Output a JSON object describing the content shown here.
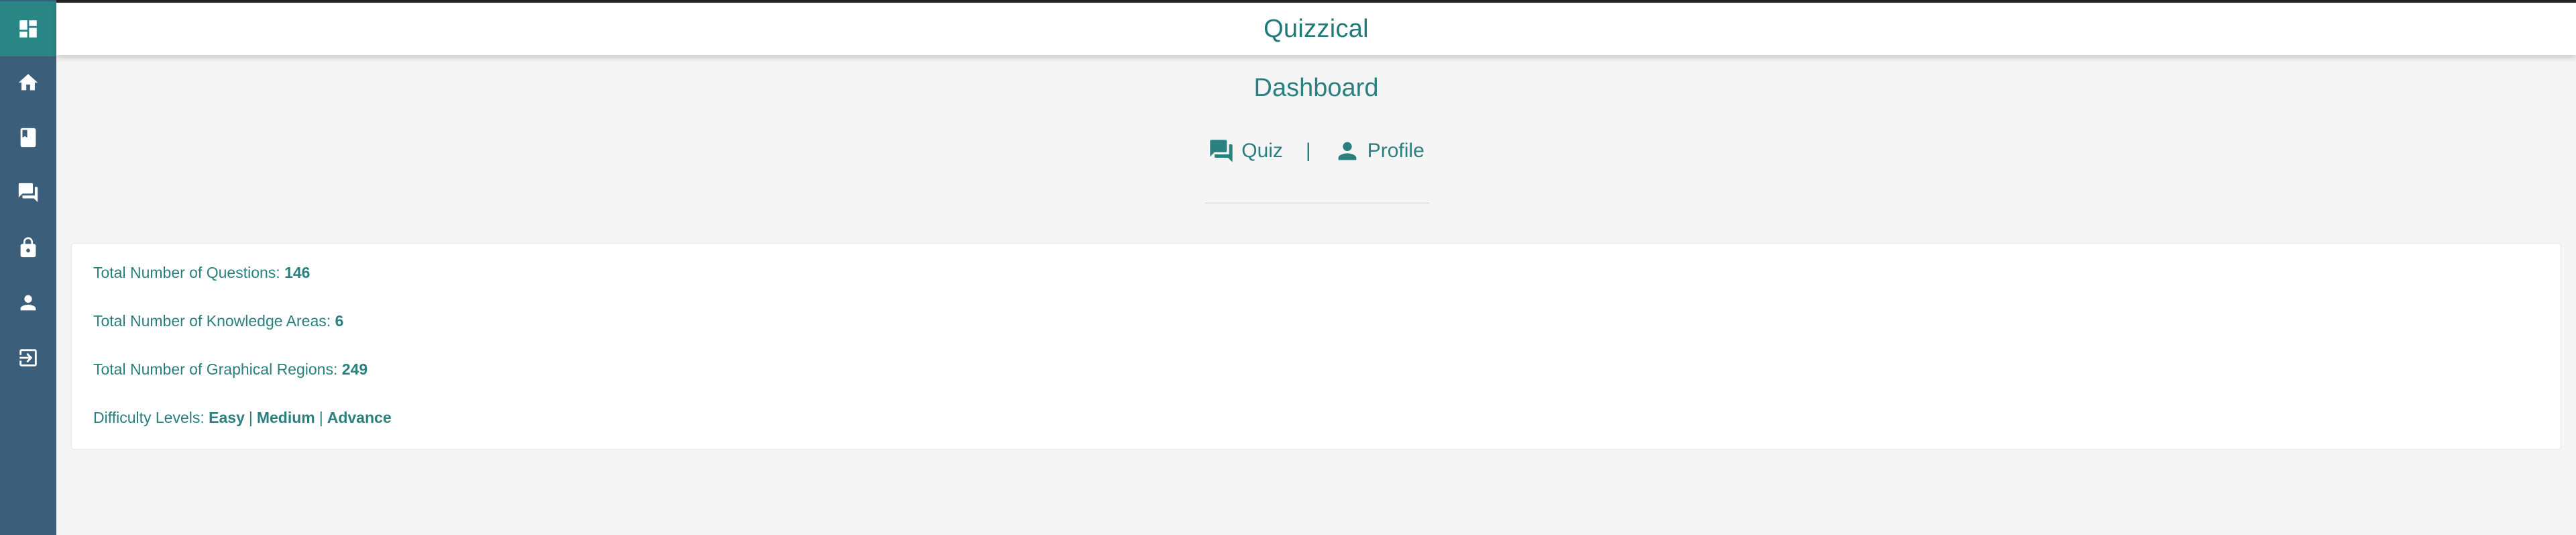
{
  "app": {
    "title": "Quizzical"
  },
  "sidebar": {
    "items": [
      {
        "name": "dashboard",
        "icon": "dashboard-icon",
        "active": true
      },
      {
        "name": "home",
        "icon": "home-icon",
        "active": false
      },
      {
        "name": "book",
        "icon": "book-icon",
        "active": false
      },
      {
        "name": "quiz",
        "icon": "forum-icon",
        "active": false
      },
      {
        "name": "lock",
        "icon": "lock-icon",
        "active": false
      },
      {
        "name": "profile",
        "icon": "person-icon",
        "active": false
      },
      {
        "name": "logout",
        "icon": "logout-icon",
        "active": false
      }
    ]
  },
  "page": {
    "title": "Dashboard"
  },
  "nav": {
    "quiz_label": "Quiz",
    "quiz_icon": "forum-icon",
    "separator": "|",
    "profile_label": "Profile",
    "profile_icon": "person-icon"
  },
  "stats": {
    "questions_label": "Total Number of Questions:",
    "questions_value": "146",
    "areas_label": "Total Number of Knowledge Areas:",
    "areas_value": "6",
    "regions_label": "Total Number of Graphical Regions:",
    "regions_value": "249",
    "difficulty_label": "Difficulty Levels:",
    "difficulty_levels": [
      "Easy",
      "Medium",
      "Advance"
    ],
    "difficulty_separator": "|"
  },
  "colors": {
    "accent": "#2a7f7f",
    "sidebar_bg": "#3b5f7b",
    "sidebar_active": "#2a8585",
    "page_bg": "#f5f5f5"
  }
}
